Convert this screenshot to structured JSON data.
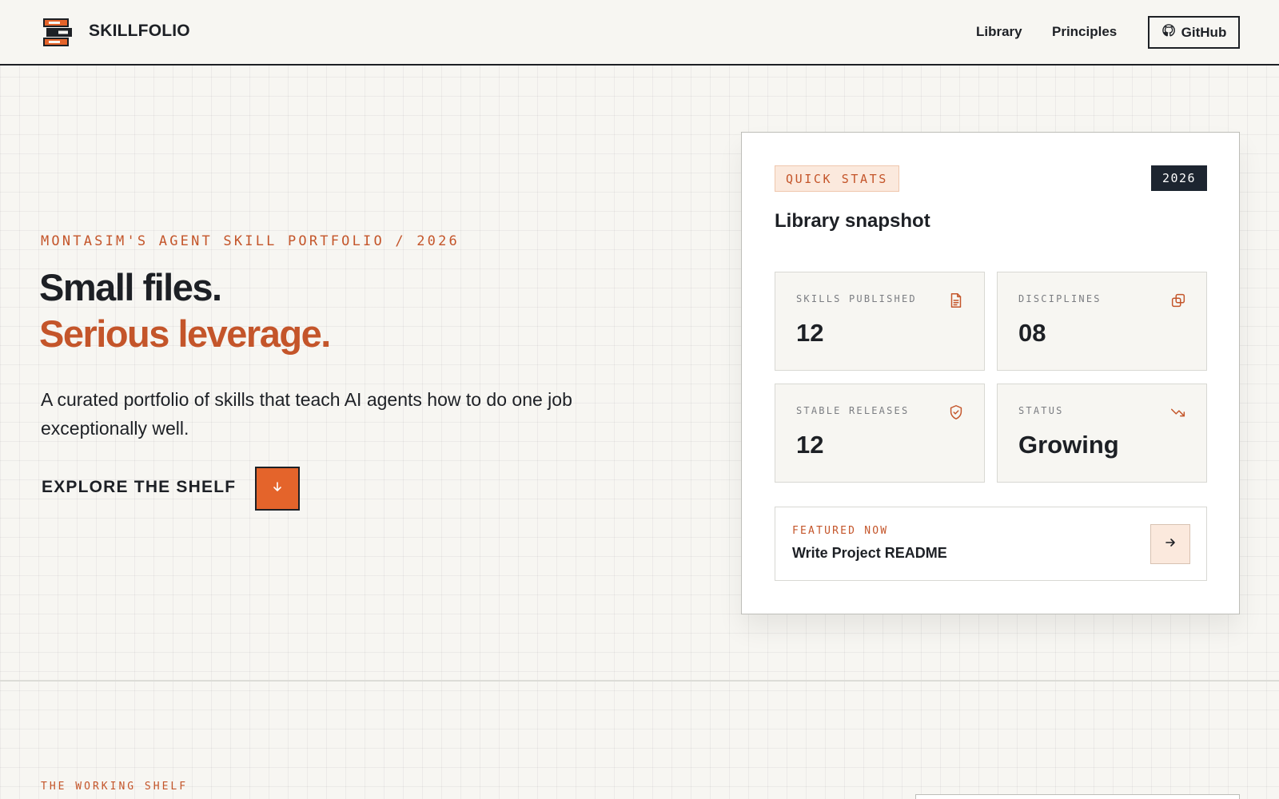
{
  "header": {
    "brand": "SKILLFOLIO",
    "logo_icon": "bookshelf-logo-icon",
    "nav": [
      {
        "label": "Library"
      },
      {
        "label": "Principles"
      }
    ],
    "github": {
      "label": "GitHub",
      "icon": "github-icon"
    }
  },
  "hero": {
    "eyebrow": "MONTASIM'S AGENT SKILL PORTFOLIO / 2026",
    "headline_line1": "Small files.",
    "headline_line2": "Serious leverage.",
    "description": "A curated portfolio of skills that teach AI agents how to do one job exceptionally well.",
    "cta_label": "EXPLORE THE SHELF",
    "cta_icon": "arrow-down-icon"
  },
  "stats_card": {
    "tag": "QUICK STATS",
    "year": "2026",
    "title": "Library snapshot",
    "stats": [
      {
        "label": "SKILLS PUBLISHED",
        "value": "12",
        "icon": "document-icon"
      },
      {
        "label": "DISCIPLINES",
        "value": "08",
        "icon": "copy-icon"
      },
      {
        "label": "STABLE RELEASES",
        "value": "12",
        "icon": "shield-check-icon"
      },
      {
        "label": "STATUS",
        "value": "Growing",
        "icon": "trend-icon"
      }
    ],
    "featured": {
      "eyebrow": "FEATURED NOW",
      "title": "Write Project README",
      "icon": "arrow-right-icon"
    }
  },
  "next_section": {
    "eyebrow": "THE WORKING SHELF"
  },
  "colors": {
    "accent": "#c4552a",
    "accent_button": "#e4642b",
    "ink": "#1d2025",
    "background": "#f7f6f2",
    "tag_background": "#fbe9dd",
    "badge_dark": "#1d2530"
  }
}
